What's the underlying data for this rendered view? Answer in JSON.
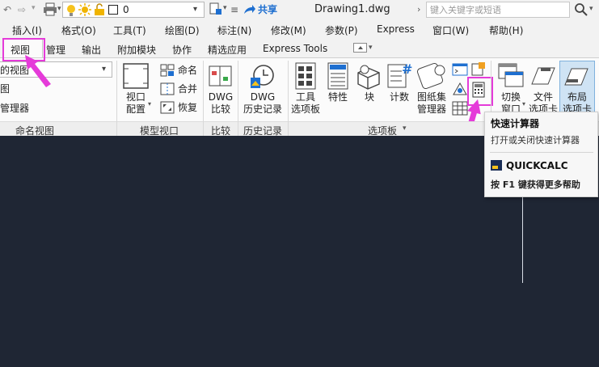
{
  "quick_access": {
    "layer_value": "0",
    "share_label": "共享",
    "document_title": "Drawing1.dwg",
    "search_placeholder": "键入关键字或短语"
  },
  "menu": [
    "插入(I)",
    "格式(O)",
    "工具(T)",
    "绘图(D)",
    "标注(N)",
    "修改(M)",
    "参数(P)",
    "Express",
    "窗口(W)",
    "帮助(H)"
  ],
  "tabs": [
    "视图",
    "管理",
    "输出",
    "附加模块",
    "协作",
    "精选应用",
    "Express Tools"
  ],
  "ribbon": {
    "named_views": {
      "dropdown_value": "的视图",
      "item1": "图",
      "item2": "管理器",
      "group_label": "命名视图"
    },
    "model_viewports": {
      "viewport_config_line1": "视口",
      "viewport_config_line2": "配置",
      "name_label": "命名",
      "merge_label": "合并",
      "restore_label": "恢复",
      "group_label": "模型视口"
    },
    "compare": {
      "line1": "DWG",
      "line2": "比较",
      "group_label": "比较"
    },
    "history": {
      "line1": "DWG",
      "line2": "历史记录",
      "group_label": "历史记录"
    },
    "palettes": {
      "tool_palettes_line1": "工具",
      "tool_palettes_line2": "选项板",
      "properties": "特性",
      "block": "块",
      "count": "计数",
      "sheetset_line1": "图纸集",
      "sheetset_line2": "管理器",
      "group_label": "选项板"
    },
    "interface": {
      "switch_line1": "切换",
      "switch_line2": "窗口",
      "file_line1": "文件",
      "file_line2": "选项卡",
      "layout_line1": "布局",
      "layout_line2": "选项卡"
    }
  },
  "tooltip": {
    "title": "快速计算器",
    "description": "打开或关闭快速计算器",
    "command": "QUICKCALC",
    "help": "按 F1 键获得更多帮助"
  },
  "colors": {
    "canvas": "#1f2634",
    "highlight": "#e53bd9",
    "accent": "#1e6fd0"
  }
}
